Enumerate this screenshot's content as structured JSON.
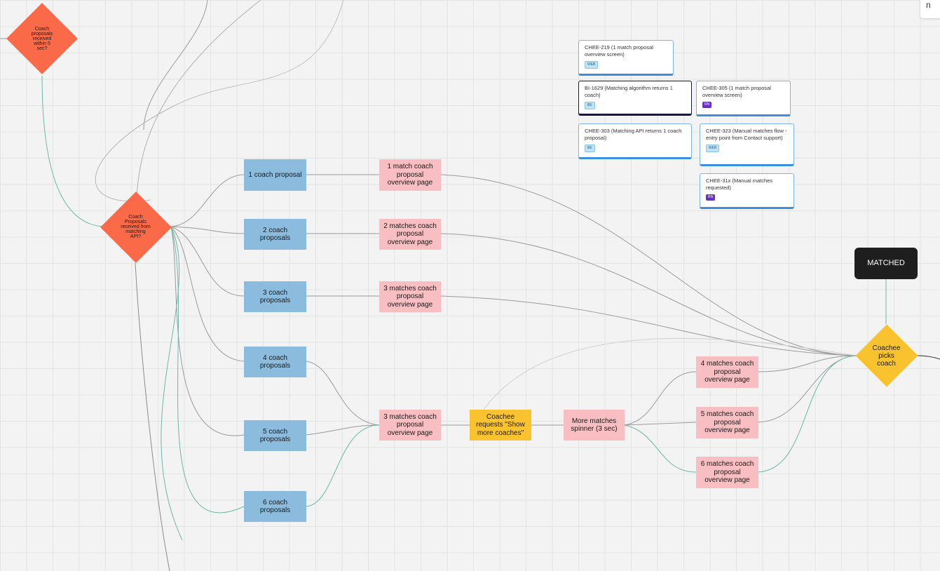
{
  "diagram": {
    "decisions": {
      "within_5_sec": "Coach proposals received within 5 sec?",
      "received_from_api": "Coach Proposals received from matching API?",
      "coachee_picks": "Coachee picks coach"
    },
    "proposals": {
      "p1": "1 coach proposal",
      "p2": "2 coach proposals",
      "p3": "3 coach proposals",
      "p4": "4 coach proposals",
      "p5": "5 coach proposals",
      "p6": "6 coach proposals"
    },
    "overview_pages": {
      "m1": "1 match coach proposal overview page",
      "m2": "2 matches coach proposal overview page",
      "m3": "3 matches coach proposal overview page",
      "m3b": "3 matches coach proposal overview page",
      "m4": "4 matches coach proposal overview page",
      "m5": "5 matches coach proposal overview page",
      "m6": "6 matches coach proposal overview page"
    },
    "request_more": "Coachee requests \"Show more coaches\"",
    "spinner": "More matches spinner (3 sec)",
    "matched": "MATCHED"
  },
  "tickets": [
    {
      "text": "CHEE-219 (1 match proposal overview screen)",
      "tag": "WEB"
    },
    {
      "text": "BI-1629 (Matching algorithm returns 1 coach)",
      "tag": "BE"
    },
    {
      "text": "CHEE-305 (1 match proposal overview screen)",
      "tag": "RN"
    },
    {
      "text": "CHEE-303 (Matching API returns 1 coach proposal)",
      "tag": "BE"
    },
    {
      "text": "CHEE-323 (Manual matches flow - entry point from Contact support)",
      "tag": "WEB"
    },
    {
      "text": "CHEE-31x (Manual matches requested)",
      "tag": "RN"
    }
  ],
  "corner_label": "n",
  "colors": {
    "decision": "#fb6a48",
    "proposal": "#8bbcde",
    "overview": "#f8bec1",
    "highlight": "#f9c32f",
    "matched": "#1e1e1e",
    "edge_grey": "#9a9a9a",
    "edge_teal": "#6cb8a8"
  }
}
